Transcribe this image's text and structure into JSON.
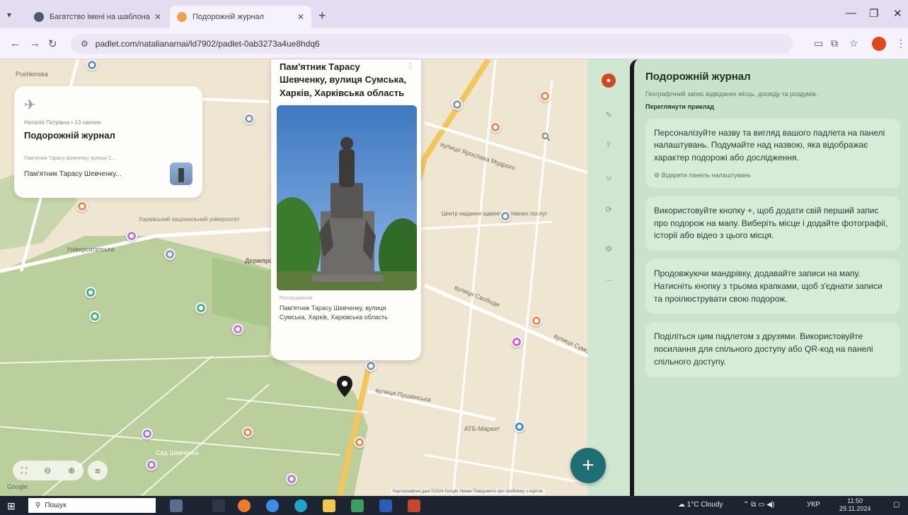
{
  "browser": {
    "tabs": [
      {
        "title": "Багатство імені на шаблонах",
        "active": false
      },
      {
        "title": "Подорожній журнал",
        "active": true
      }
    ],
    "url": "padlet.com/natalianarnai/ld7902/padlet-0ab3273a4ue8hdq6"
  },
  "board": {
    "meta": "Наталія Петрівна • 13 хвилин",
    "title": "Подорожній журнал",
    "post_small": "Пам'ятник Тарасу Шевченку, вулиця С...",
    "post_short": "Пам'ятник Тарасу Шевченку..."
  },
  "post": {
    "title": "Пам'ятник Тарасу Шевченку, вулиця Сумська, Харків, Харківська область",
    "label": "Розташування",
    "caption": "Пам'ятник Тарасу Шевченку, вулиця Сумська, Харків, Харківська область"
  },
  "map": {
    "labels": {
      "l1": "Pushkinska",
      "l2": "вулиця Ярослава Мудрого",
      "l3": "Центр надання адміністративних послуг",
      "l4": "вулиця Свободи",
      "l5": "вулиця Сумська",
      "l6": "вулиця Пушкінська",
      "l7": "Харківський національний університет",
      "l8": "Держпром",
      "l9": "Університетська",
      "l10": "Сад Шевченка",
      "l11": "АТБ-Маркет"
    },
    "attribution": "Картографічні дані ©2024 Google  Умови  Повідомити про проблему з картою",
    "google": "Google"
  },
  "panel": {
    "title": "Подорожній журнал",
    "description": "Географічний запис відвіданих місць, досвіду та роздумів.",
    "example_link": "Переглянути приклад",
    "tips": [
      {
        "text": "Персоналізуйте назву та вигляд вашого падлета на панелі налаштувань. Подумайте над назвою, яка відображає характер подорожі або дослідження.",
        "action": "Відкрити панель налаштувань"
      },
      {
        "text": "Використовуйте кнопку +, щоб додати свій перший запис про подорож на мапу. Виберіть місце і додайте фотографії, історії або відео з цього місця.",
        "action": ""
      },
      {
        "text": "Продовжуючи мандрівку, додавайте записи на мапу. Натисніть кнопку з трьома крапками, щоб з'єднати записи та проілюструвати свою подорож.",
        "action": ""
      },
      {
        "text": "Поділіться цим падлетом з друзями. Використовуйте посилання для спільного доступу або QR-код на панелі спільного доступу.",
        "action": ""
      }
    ]
  },
  "taskbar": {
    "search": "Пошук",
    "weather": "1°C Cloudy",
    "lang": "УКР",
    "time": "11:50",
    "date": "29.11.2024"
  },
  "colors": {
    "panel_bg": "#c9e2cc",
    "fab": "#1f6e74",
    "avatar": "#d24621",
    "map_bg": "#efe6d2",
    "park": "#a9c78a"
  }
}
